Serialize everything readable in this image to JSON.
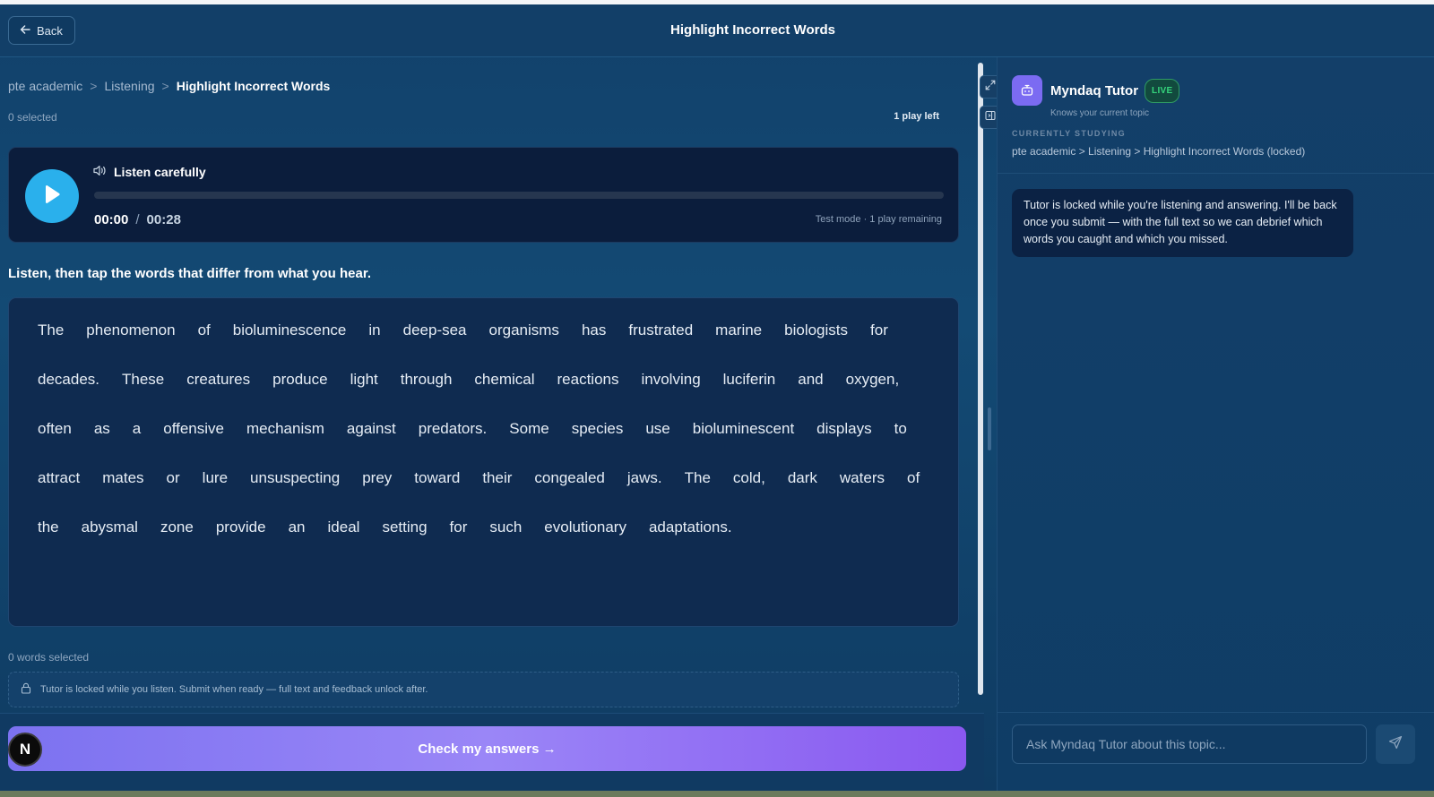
{
  "header": {
    "back_label": "Back",
    "title": "Highlight Incorrect Words"
  },
  "breadcrumb": {
    "items": [
      "pte academic",
      "Listening",
      "Highlight Incorrect Words"
    ],
    "separator": ">"
  },
  "status": {
    "selected": "0 selected",
    "plays_left": "1 play left"
  },
  "player": {
    "label": "Listen carefully",
    "current_time": "00:00",
    "separator": "/",
    "duration": "00:28",
    "progress": 0,
    "mode": "Test mode · 1 play remaining"
  },
  "instructions": "Listen, then tap the words that differ from what you hear.",
  "passage_words": [
    "The",
    "phenomenon",
    "of",
    "bioluminescence",
    "in",
    "deep-sea",
    "organisms",
    "has",
    "frustrated",
    "marine",
    "biologists",
    "for",
    "decades.",
    "These",
    "creatures",
    "produce",
    "light",
    "through",
    "chemical",
    "reactions",
    "involving",
    "luciferin",
    "and",
    "oxygen,",
    "often",
    "as",
    "a",
    "offensive",
    "mechanism",
    "against",
    "predators.",
    "Some",
    "species",
    "use",
    "bioluminescent",
    "displays",
    "to",
    "attract",
    "mates",
    "or",
    "lure",
    "unsuspecting",
    "prey",
    "toward",
    "their",
    "congealed",
    "jaws.",
    "The",
    "cold,",
    "dark",
    "waters",
    "of",
    "the",
    "abysmal",
    "zone",
    "provide",
    "an",
    "ideal",
    "setting",
    "for",
    "such",
    "evolutionary",
    "adaptations."
  ],
  "words_selected": "0 words selected",
  "lock_note": "Tutor is locked while you listen. Submit when ready — full text and feedback unlock after.",
  "check_button": "Check my answers →",
  "avatar_letter": "N",
  "tutor": {
    "name": "Myndaq Tutor",
    "badge": "LIVE",
    "subtitle": "Knows your current topic",
    "currently_label": "CURRENTLY STUDYING",
    "currently_value": "pte academic > Listening > Highlight Incorrect Words (locked)",
    "message": "Tutor is locked while you're listening and answering. I'll be back once you submit — with the full text so we can debrief which words you caught and which you missed.",
    "input_placeholder": "Ask Myndaq Tutor about this topic..."
  },
  "icons": {
    "back": "arrow-left-icon",
    "play": "play-icon",
    "speaker": "speaker-icon",
    "lock": "lock-icon",
    "expand": "expand-icon",
    "panel": "panel-icon",
    "bot": "bot-icon",
    "send": "send-icon"
  },
  "colors": {
    "accent": "#2ab0ec",
    "button_gradient_start": "#7c72f0",
    "button_gradient_end": "#8a58f0",
    "live": "#35d47c",
    "bot": "#7b6bf2"
  }
}
